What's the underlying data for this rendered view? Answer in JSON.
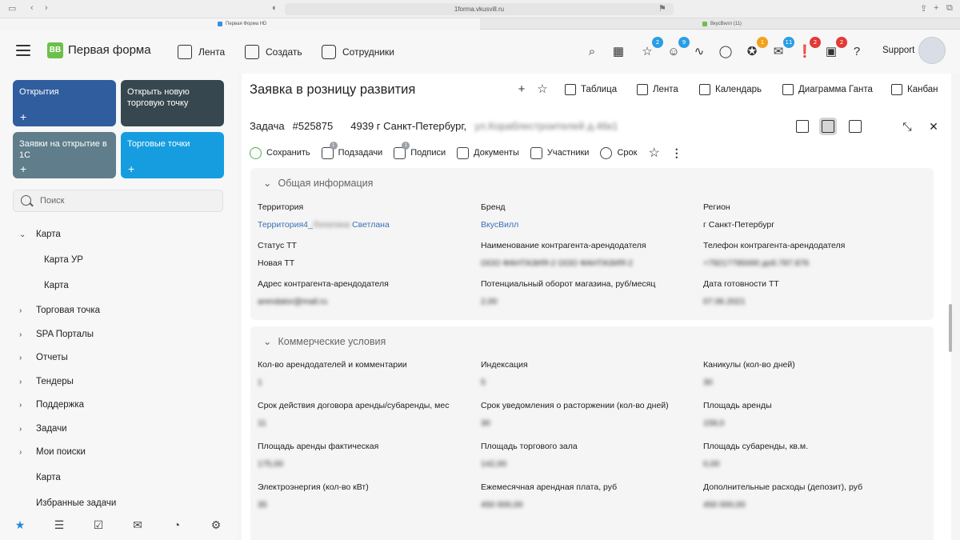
{
  "browser": {
    "url": "1forma.vkusvill.ru",
    "tabs": [
      {
        "title": "Первая Форма HD"
      },
      {
        "title": "ВкусВилл (11)"
      }
    ]
  },
  "header": {
    "brand": "Первая форма",
    "logo_text": "BB",
    "nav": [
      {
        "label": "Лента"
      },
      {
        "label": "Создать"
      },
      {
        "label": "Сотрудники"
      }
    ],
    "badges": [
      "2",
      "9",
      "1",
      "11",
      "2",
      "2"
    ],
    "badge_colors": [
      "#2a9ee4",
      "#2a9ee4",
      "#f4a21b",
      "#2a9ee4",
      "#e53935",
      "#e53935"
    ],
    "user": "Support"
  },
  "sidebar": {
    "tiles": [
      {
        "label": "Открытия",
        "color": "#2f5d9e"
      },
      {
        "label": "Открыть новую торговую точку",
        "color": "#37474f"
      },
      {
        "label": "Заявки на открытие в 1С",
        "color": "#5f7d8a"
      },
      {
        "label": "Торговые точки",
        "color": "#169de0"
      }
    ],
    "search_placeholder": "Поиск",
    "tree": [
      {
        "label": "Карта",
        "expanded": true
      },
      {
        "label": "Карта УР"
      },
      {
        "label": "Карта"
      },
      {
        "label": "Торговая точка"
      },
      {
        "label": "SPA Порталы"
      },
      {
        "label": "Отчеты"
      },
      {
        "label": "Тендеры"
      },
      {
        "label": "Поддержка"
      },
      {
        "label": "Задачи"
      },
      {
        "label": "Мои поиски"
      },
      {
        "label": "Карта"
      },
      {
        "label": "Избранные задачи"
      }
    ]
  },
  "main": {
    "title": "Заявка в розницу развития",
    "views": [
      {
        "label": "Таблица"
      },
      {
        "label": "Лента"
      },
      {
        "label": "Календарь"
      },
      {
        "label": "Диаграмма Ганта"
      },
      {
        "label": "Канбан"
      }
    ],
    "task": {
      "prefix": "Задача",
      "number": "#525875",
      "title": "4939 г Санкт-Петербург,",
      "title_blurred": "ул.Кораблестроителей д.46к1"
    },
    "toolbar": [
      {
        "label": "Сохранить"
      },
      {
        "label": "Подзадачи",
        "badge": "1"
      },
      {
        "label": "Подписи",
        "badge": "1"
      },
      {
        "label": "Документы"
      },
      {
        "label": "Участники"
      },
      {
        "label": "Срок"
      }
    ],
    "sections": [
      {
        "title": "Общая информация",
        "fields": [
          {
            "label": "Территория",
            "value": "Территория4_",
            "blur": "Лопатина ",
            "value2": "Светлана"
          },
          {
            "label": "Бренд",
            "value": "ВкусВилл"
          },
          {
            "label": "Регион",
            "value": "г Санкт-Петербург"
          },
          {
            "label": "Статус ТТ",
            "value": "Новая ТТ"
          },
          {
            "label": "Наименование контрагента-арендодателя",
            "blur": "ООО ФАНТАЗИЯ-2 ООО ФАНТАЗИЯ-2"
          },
          {
            "label": "Телефон контрагента-арендодателя",
            "blur": "+79217795000 доб.787.876"
          },
          {
            "label": "Адрес контрагента-арендодателя",
            "blur": "arendator@mail.ru"
          },
          {
            "label": "Потенциальный оборот магазина, руб/месяц",
            "blur": "2,00"
          },
          {
            "label": "Дата готовности ТТ",
            "blur": "07.06.2021"
          }
        ]
      },
      {
        "title": "Коммерческие условия",
        "fields": [
          {
            "label": "Кол-во арендодателей и комментарии",
            "blur": "1"
          },
          {
            "label": "Индексация",
            "blur": "5"
          },
          {
            "label": "Каникулы (кол-во дней)",
            "blur": "30"
          },
          {
            "label": "Срок действия договора аренды/субаренды, мес",
            "blur": "11"
          },
          {
            "label": "Срок уведомления о расторжении (кол-во дней)",
            "blur": "30"
          },
          {
            "label": "Площадь аренды",
            "blur": "159,0"
          },
          {
            "label": "Площадь аренды фактическая",
            "blur": "175,00"
          },
          {
            "label": "Площадь торгового зала",
            "blur": "142,00"
          },
          {
            "label": "Площадь субаренды, кв.м.",
            "blur": "0,00"
          },
          {
            "label": "Электроэнергия (кол-во кВт)",
            "blur": "35"
          },
          {
            "label": "Ежемесячная арендная плата, руб",
            "blur": "450 000,00"
          },
          {
            "label": "Дополнительные расходы (депозит), руб",
            "blur": "450 000,00"
          }
        ]
      }
    ]
  }
}
